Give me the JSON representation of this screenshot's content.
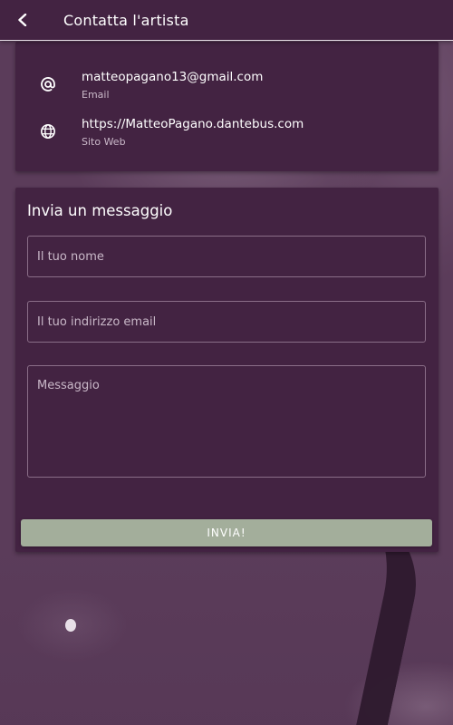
{
  "appbar": {
    "title": "Contatta l'artista",
    "back_icon": "chevron-left-icon"
  },
  "contact": {
    "email": {
      "value": "matteopagano13@gmail.com",
      "label": "Email",
      "icon": "at-sign-icon"
    },
    "website": {
      "value": "https://MatteoPagano.dantebus.com",
      "label": "Sito Web",
      "icon": "globe-icon"
    }
  },
  "form": {
    "title": "Invia un messaggio",
    "name_placeholder": "Il tuo nome",
    "email_placeholder": "Il tuo indirizzo email",
    "message_placeholder": "Messaggio",
    "send_label": "INVIA!"
  },
  "colors": {
    "card_bg": "#432342",
    "page_bg": "#5b3c5a",
    "button_bg": "#a3ae9b",
    "field_border": "#8a6e88"
  }
}
